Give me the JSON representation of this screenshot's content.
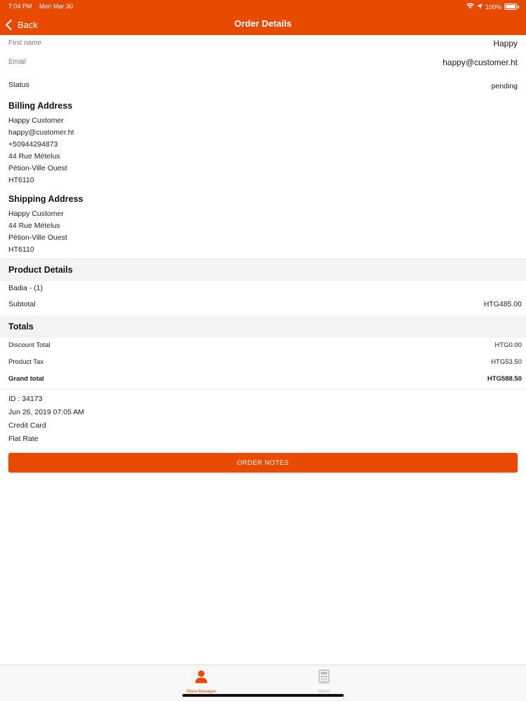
{
  "status_bar": {
    "time": "7:04 PM",
    "date": "Mon Mar 30",
    "battery": "100%"
  },
  "nav": {
    "back_label": "Back",
    "title": "Order Details"
  },
  "customer": {
    "first_name_label": "First name",
    "first_name": "Happy",
    "email_label": "Email",
    "email": "happy@customer.ht",
    "status_label": "Status",
    "status": "pending"
  },
  "billing": {
    "title": "Billing Address",
    "lines": [
      "Happy Customer",
      "happy@customer.ht",
      "+50944294873",
      "44 Rue Mételus",
      "Pétion-Ville Ouest",
      "HT6110"
    ]
  },
  "shipping": {
    "title": "Shipping Address",
    "lines": [
      "Happy Customer",
      "44 Rue Mételus",
      "Pétion-Ville Ouest",
      "HT6110"
    ]
  },
  "product_details": {
    "title": "Product Details",
    "item": "Badia - (1)",
    "subtotal_label": "Subtotal",
    "subtotal": "HTG485.00"
  },
  "totals": {
    "title": "Totals",
    "discount_label": "Discount Total",
    "discount": "HTG0.00",
    "tax_label": "Product Tax",
    "tax": "HTG53.50",
    "grand_label": "Grand total",
    "grand": "HTG588.50"
  },
  "order_meta": {
    "id": "ID : 34173",
    "date": "Jun 26, 2019 07:05 AM",
    "payment": "Credit Card",
    "shipping_method": "Flat Rate"
  },
  "order_notes_button": "ORDER NOTES",
  "tabbar": {
    "tabs": [
      {
        "label": "Store Manager",
        "icon": "person-icon"
      },
      {
        "label": "About",
        "icon": "calculator-icon"
      }
    ]
  },
  "colors": {
    "accent": "#e84a00",
    "inactive_tab": "#b5b5b5",
    "band": "#f3f3f4"
  }
}
